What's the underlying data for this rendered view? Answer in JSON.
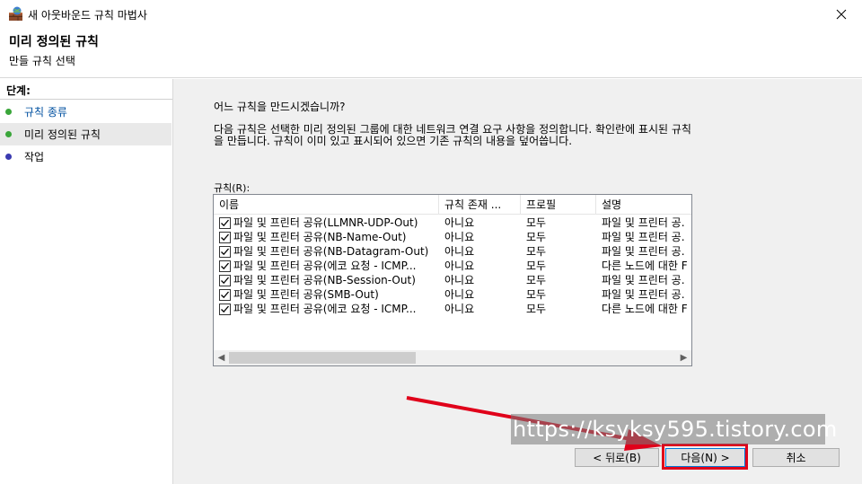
{
  "window": {
    "title": "새 아웃바운드 규칙 마법사",
    "icon": "firewall-app-icon"
  },
  "header": {
    "title": "미리 정의된 규칙",
    "subtitle": "만들 규칙 선택"
  },
  "sidebar": {
    "steps_label": "단계:",
    "items": [
      {
        "label": "규칙 종류",
        "dot_color": "#3aa63a",
        "link": true
      },
      {
        "label": "미리 정의된 규칙",
        "dot_color": "#3aa63a",
        "active": true
      },
      {
        "label": "작업",
        "dot_color": "#3a3ab0"
      }
    ]
  },
  "main": {
    "question": "어느 규칙을 만드시겠습니까?",
    "description": "다음 규칙은 선택한 미리 정의된 그룹에 대한 네트워크 연결 요구 사항을 정의합니다. 확인란에 표시된 규칙을 만듭니다. 규칙이 이미 있고 표시되어 있으면 기존 규칙의 내용을 덮어씁니다.",
    "rules_label": "규칙(R):",
    "columns": [
      "이름",
      "규칙 존재 ...",
      "프로필",
      "설명"
    ],
    "rows": [
      {
        "name": "파일 및 프린터 공유(LLMNR-UDP-Out)",
        "exists": "아니요",
        "profile": "모두",
        "desc": "파일 및 프린터 공."
      },
      {
        "name": "파일 및 프린터 공유(NB-Name-Out)",
        "exists": "아니요",
        "profile": "모두",
        "desc": "파일 및 프린터 공."
      },
      {
        "name": "파일 및 프린터 공유(NB-Datagram-Out)",
        "exists": "아니요",
        "profile": "모두",
        "desc": "파일 및 프린터 공."
      },
      {
        "name": "파일 및 프린터 공유(에코 요청 - ICMP...",
        "exists": "아니요",
        "profile": "모두",
        "desc": "다른 노드에 대한 F"
      },
      {
        "name": "파일 및 프린터 공유(NB-Session-Out)",
        "exists": "아니요",
        "profile": "모두",
        "desc": "파일 및 프린터 공."
      },
      {
        "name": "파일 및 프린터 공유(SMB-Out)",
        "exists": "아니요",
        "profile": "모두",
        "desc": "파일 및 프린터 공."
      },
      {
        "name": "파일 및 프린터 공유(에코 요청 - ICMP...",
        "exists": "아니요",
        "profile": "모두",
        "desc": "다른 노드에 대한 F"
      }
    ]
  },
  "buttons": {
    "back": "< 뒤로(B)",
    "next": "다음(N) >",
    "cancel": "취소"
  },
  "overlay": {
    "watermark": "https://ksyksy595.tistory.com",
    "highlight_color": "#e0001a"
  }
}
